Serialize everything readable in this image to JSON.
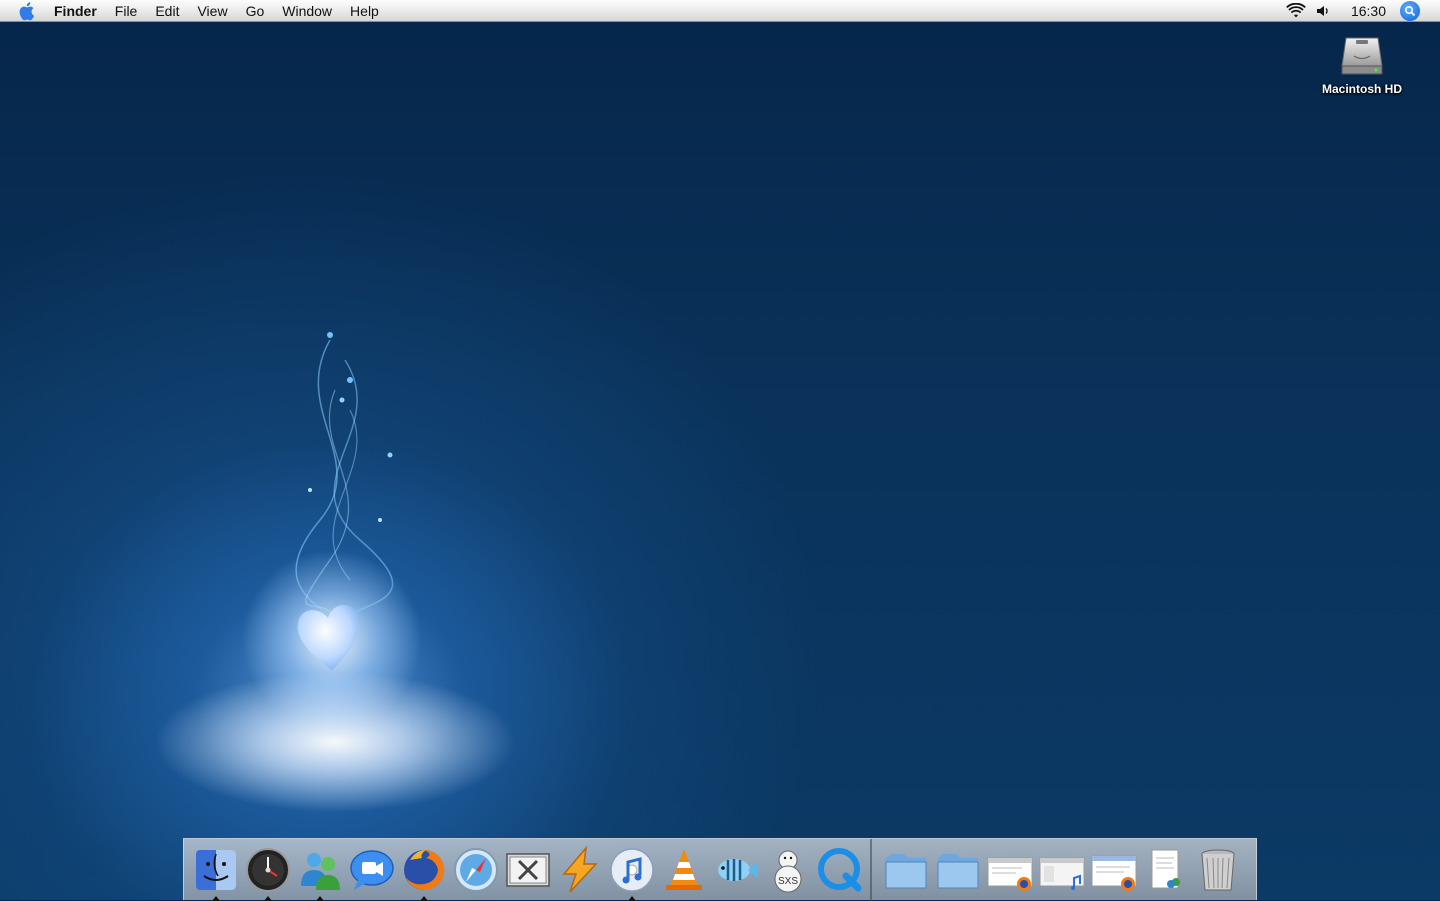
{
  "menubar": {
    "apple_icon": "apple-icon",
    "app_name": "Finder",
    "menus": [
      "File",
      "Edit",
      "View",
      "Go",
      "Window",
      "Help"
    ],
    "status_icons": [
      "wifi-icon",
      "volume-icon"
    ],
    "clock": "16:30",
    "spotlight_icon": "spotlight-icon"
  },
  "desktop": {
    "icons": [
      {
        "label": "Macintosh HD",
        "icon": "hard-drive-icon"
      }
    ]
  },
  "dock": {
    "apps": [
      {
        "icon": "finder-icon",
        "running": true
      },
      {
        "icon": "dashboard-icon",
        "running": true
      },
      {
        "icon": "messenger-icon",
        "running": true
      },
      {
        "icon": "ichat-icon",
        "running": false
      },
      {
        "icon": "firefox-icon",
        "running": true
      },
      {
        "icon": "safari-icon",
        "running": false
      },
      {
        "icon": "chat-x-icon",
        "running": false
      },
      {
        "icon": "bolt-app-icon",
        "running": false
      },
      {
        "icon": "itunes-icon",
        "running": true
      },
      {
        "icon": "vlc-icon",
        "running": false
      },
      {
        "icon": "fish-app-icon",
        "running": false
      },
      {
        "icon": "snowman-app-icon",
        "running": false
      },
      {
        "icon": "quicktime-icon",
        "running": false
      }
    ],
    "docs": [
      {
        "icon": "folder-icon"
      },
      {
        "icon": "folder-icon"
      },
      {
        "icon": "firefox-window-icon"
      },
      {
        "icon": "itunes-window-icon"
      },
      {
        "icon": "firefox-window-icon"
      },
      {
        "icon": "messenger-document-icon"
      },
      {
        "icon": "trash-icon"
      }
    ]
  },
  "colors": {
    "desktop_bg": "#0a325a",
    "menubar_bg": "#e9e9e9",
    "spotlight": "#1160d6"
  }
}
